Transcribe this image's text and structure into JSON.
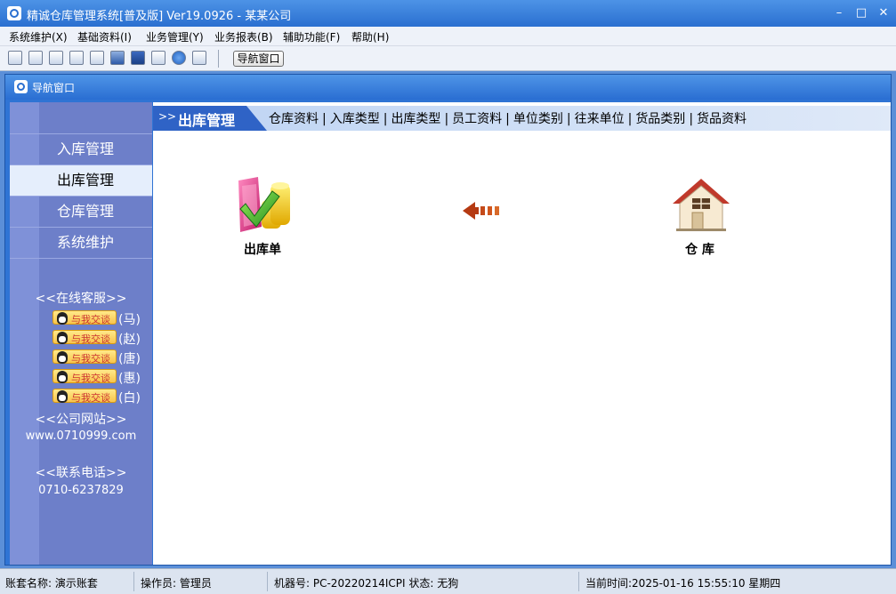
{
  "window": {
    "title": "精诚仓库管理系统[普及版] Ver19.0926  -  某某公司",
    "min_label": "–",
    "max_label": "□",
    "close_label": "✕"
  },
  "menu": [
    "系统维护(X)",
    "基础资料(I)",
    "业务管理(Y)",
    "业务报表(B)",
    "辅助功能(F)",
    "帮助(H)"
  ],
  "toolbar": {
    "icons": [
      "table-icon",
      "form-icon",
      "windows-icon",
      "search-icon",
      "refresh-icon",
      "screen-icon",
      "save-icon",
      "print-icon",
      "help-icon",
      "exit-icon"
    ],
    "nav_button": "导航窗口"
  },
  "child_window": {
    "title": "导航窗口"
  },
  "sidebar": {
    "items": [
      "入库管理",
      "出库管理",
      "仓库管理",
      "系统维护"
    ],
    "active_index": 1,
    "online_service": "<<在线客服>>",
    "chat_label": "与我交谈",
    "agents": [
      "(马)",
      "(赵)",
      "(唐)",
      "(惠)",
      "(白)"
    ],
    "website_title": "<<公司网站>>",
    "website": "www.0710999.com",
    "phone_title": "<<联系电话>>",
    "phone": "0710-6237829"
  },
  "main": {
    "header_arrow": ">>",
    "header_title": "出库管理",
    "links": [
      "仓库资料",
      "入库类型",
      "出库类型",
      "员工资料",
      "单位类别",
      "往来单位",
      "货品类别",
      "货品资料"
    ],
    "link_separator": "|",
    "flow": [
      {
        "label": "出库单",
        "icon": "outbound-order-icon"
      },
      {
        "label": "仓  库",
        "icon": "warehouse-icon"
      }
    ]
  },
  "statusbar": {
    "account": "账套名称:  演示账套",
    "operator": "操作员:  管理员",
    "machine": "机器号:  PC-20220214ICPI 状态:  无狗",
    "time": "当前时间:2025-01-16 15:55:10 星期四"
  },
  "colors": {
    "titlebar": "#2a6fd0",
    "sidebar": "#6d7fc9",
    "header_tab": "#2f63c6",
    "active_nav": "#e5eefc"
  }
}
